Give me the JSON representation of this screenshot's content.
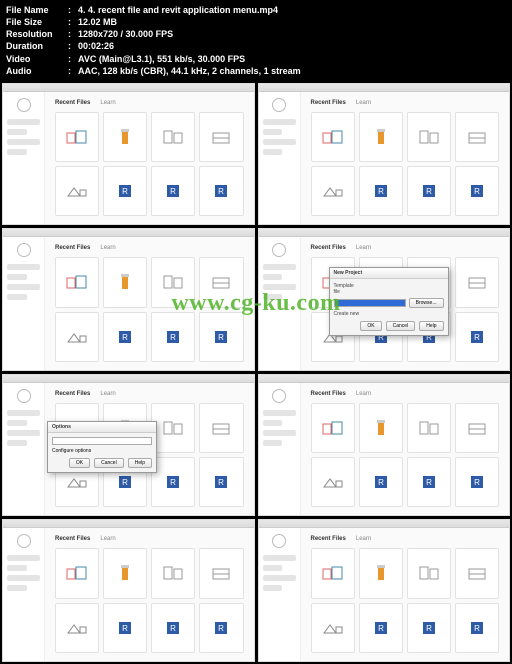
{
  "meta": {
    "filename_label": "File Name",
    "filename": "4. 4. recent file and revit application menu.mp4",
    "filesize_label": "File Size",
    "filesize": "12.02 MB",
    "resolution_label": "Resolution",
    "resolution": "1280x720 / 30.000 FPS",
    "duration_label": "Duration",
    "duration": "00:02:26",
    "video_label": "Video",
    "video": "AVC (Main@L3.1), 551 kb/s, 30.000 FPS",
    "audio_label": "Audio",
    "audio": "AAC, 128 kb/s (CBR), 44.1 kHz, 2 channels, 1 stream"
  },
  "tabs": {
    "recent": "Recent Files",
    "learn": "Learn"
  },
  "dialog_newproject": {
    "title": "New Project",
    "templatefile_label": "Template file",
    "createnew_label": "Create new",
    "browse": "Browse...",
    "ok": "OK",
    "cancel": "Cancel",
    "help": "Help"
  },
  "dialog_options": {
    "title": "Options",
    "info": "Configure options",
    "ok": "OK",
    "cancel": "Cancel",
    "help": "Help"
  },
  "watermark": "www.cg-ku.com"
}
